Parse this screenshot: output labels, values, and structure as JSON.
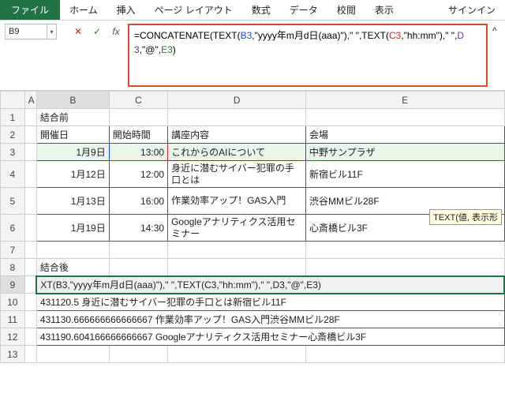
{
  "ribbon": {
    "file": "ファイル",
    "tabs": [
      "ホーム",
      "挿入",
      "ページ レイアウト",
      "数式",
      "データ",
      "校閲",
      "表示"
    ],
    "signin": "サインイン"
  },
  "name_box": "B9",
  "fx_buttons": {
    "cancel": "✕",
    "confirm": "✓",
    "fx": "fx"
  },
  "formula": {
    "parts": [
      {
        "t": "=CONCATENATE(TEXT(",
        "c": "tok-text"
      },
      {
        "t": "B3",
        "c": "tok-ref-b"
      },
      {
        "t": ",\"yyyy年m月d日(aaa)\"),\" \",TEXT(",
        "c": "tok-text"
      },
      {
        "t": "C3",
        "c": "tok-ref-c"
      },
      {
        "t": ",\"hh:mm\"),\" \",",
        "c": "tok-text"
      },
      {
        "t": "D3",
        "c": "tok-ref-d"
      },
      {
        "t": ",\"@\",",
        "c": "tok-text"
      },
      {
        "t": "E3",
        "c": "tok-ref-e"
      },
      {
        "t": ")",
        "c": "tok-text"
      }
    ],
    "expand": "^"
  },
  "tooltip": "TEXT(値, 表示形",
  "columns": [
    "A",
    "B",
    "C",
    "D",
    "E"
  ],
  "row_numbers": [
    1,
    2,
    3,
    4,
    5,
    6,
    7,
    8,
    9,
    10,
    11,
    12,
    13
  ],
  "sheet": {
    "r1": {
      "b": "結合前"
    },
    "r2": {
      "b": "開催日",
      "c": "開始時間",
      "d": "講座内容",
      "e": "会場"
    },
    "r3": {
      "b": "1月9日",
      "c": "13:00",
      "d": "これからのAIについて",
      "e": "中野サンプラザ"
    },
    "r4": {
      "b": "1月12日",
      "c": "12:00",
      "d": "身近に潜むサイバー犯罪の手口とは",
      "e": "新宿ビル11F"
    },
    "r5": {
      "b": "1月13日",
      "c": "16:00",
      "d": "作業効率アップ！GAS入門",
      "e": "渋谷MMビル28F"
    },
    "r6": {
      "b": "1月19日",
      "c": "14:30",
      "d": "Googleアナリティクス活用セミナー",
      "e": "心斎橋ビル3F"
    },
    "r8": {
      "b": "結合後"
    },
    "r9": "XT(B3,\"yyyy年m月d日(aaa)\"),\" \",TEXT(C3,\"hh:mm\"),\" \",D3,\"@\",E3)",
    "r10": "431120.5 身近に潜むサイバー犯罪の手口とは新宿ビル11F",
    "r11": "431130.666666666666667 作業効率アップ！GAS入門渋谷MMビル28F",
    "r12": "431190.604166666666667 Googleアナリティクス活用セミナー心斎橋ビル3F"
  }
}
